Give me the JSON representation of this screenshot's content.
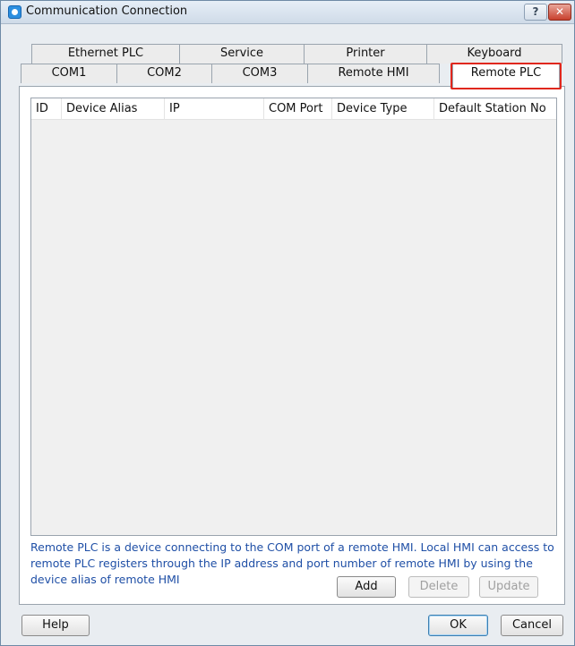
{
  "window": {
    "title": "Communication Connection",
    "help_glyph": "?",
    "close_glyph": "✕"
  },
  "tabs_row1": [
    "Ethernet PLC",
    "Service",
    "Printer",
    "Keyboard"
  ],
  "tabs_row2": [
    "COM1",
    "COM2",
    "COM3",
    "Remote HMI",
    "Remote PLC"
  ],
  "selected_tab": "Remote PLC",
  "highlight_color": "#e0271d",
  "table": {
    "columns": [
      "ID",
      "Device Alias",
      "IP",
      "COM Port",
      "Device Type",
      "Default Station No"
    ],
    "rows": []
  },
  "description": "Remote PLC is a device connecting to the COM port of a remote HMI. Local HMI can access to remote PLC registers through the IP address and port number of remote HMI by using the device alias of remote HMI",
  "panel_buttons": {
    "add": "Add",
    "delete": "Delete",
    "update": "Update"
  },
  "footer_buttons": {
    "help": "Help",
    "ok": "OK",
    "cancel": "Cancel"
  },
  "colors": {
    "description_text": "#1f4fa6",
    "close_button": "#c8402d"
  }
}
